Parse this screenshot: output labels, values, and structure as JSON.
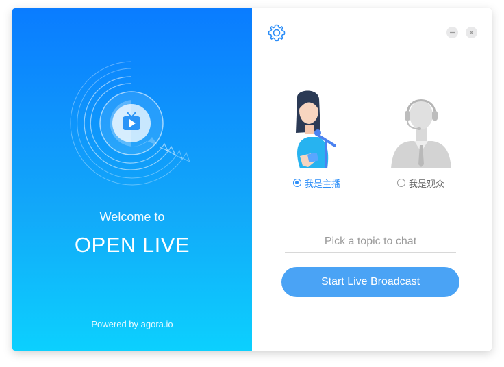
{
  "app": {
    "welcome": "Welcome to",
    "brand": "OPEN LIVE",
    "powered_by": "Powered by agora.io"
  },
  "icons": {
    "logo": "live-tv-chat-icon",
    "settings": "gear-icon",
    "minimize": "minimize-icon",
    "close": "close-icon"
  },
  "roles": [
    {
      "label": "我是主播",
      "selected": true
    },
    {
      "label": "我是观众",
      "selected": false
    }
  ],
  "topic": {
    "placeholder": "Pick a topic to chat",
    "value": ""
  },
  "start_button": "Start Live Broadcast",
  "colors": {
    "accent": "#2c8ef8",
    "button": "#4aa3f5",
    "gradient_top": "#0a7cff",
    "gradient_bottom": "#0cd0fe"
  }
}
